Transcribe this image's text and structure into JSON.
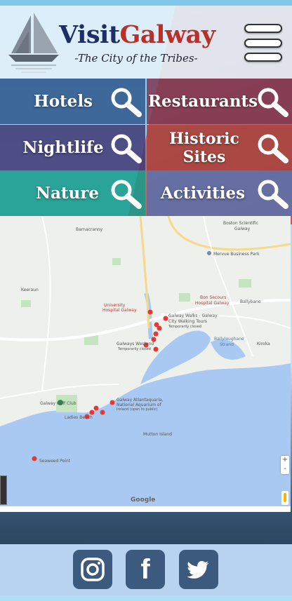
{
  "header": {
    "brand_first": "Visit",
    "brand_second": "Galway",
    "tagline": "-The City of the Tribes-"
  },
  "categories": [
    {
      "label": "Hotels"
    },
    {
      "label": "Restaurants"
    },
    {
      "label": "Nightlife"
    },
    {
      "label": "Historic Sites"
    },
    {
      "label": "Nature"
    },
    {
      "label": "Activities"
    }
  ],
  "map": {
    "places": {
      "barnacranny": "Barnacranny",
      "boston_scientific": "Boston Scientific",
      "boston_scientific_2": "Galway",
      "mervue": "Mervue Business Park",
      "keeraun": "Keeraun",
      "univ_hospital": "University",
      "univ_hospital_2": "Hospital Galway",
      "bon_secours": "Bon Secours",
      "bon_secours_2": "Hospital Galway",
      "ballybane": "Ballybane",
      "galway_walks": "Galway Walks - Galway",
      "galway_walks_2": "City Walking Tours",
      "galway_walks_3": "Temporarily closed",
      "galways_westend": "Galways Westend",
      "galways_westend_2": "Temporarily closed",
      "ballyloughane": "Ballyloughane",
      "ballyloughane_2": "Strand",
      "kiroka": "Kiroka",
      "galway_golf": "Galway Golf Club",
      "ladies_beach": "Ladies Beach",
      "atlantaquaria": "Galway Atlantaquaria,",
      "atlantaquaria_2": "National Aquarium of",
      "atlantaquaria_3": "Ireland (open to public)",
      "mutton_island": "Mutton Island",
      "seaweed_point": "Seaweed Point",
      "google": "Google"
    },
    "zoom_in": "+",
    "zoom_out": "-"
  },
  "social": [
    {
      "name": "instagram"
    },
    {
      "name": "facebook",
      "glyph": "f"
    },
    {
      "name": "twitter"
    }
  ],
  "colors": {
    "brand_visit": "#1d2f66",
    "brand_galway": "#b7312a",
    "footer_bg": "#bedaf6",
    "social_bg": "#3b5a7e"
  }
}
